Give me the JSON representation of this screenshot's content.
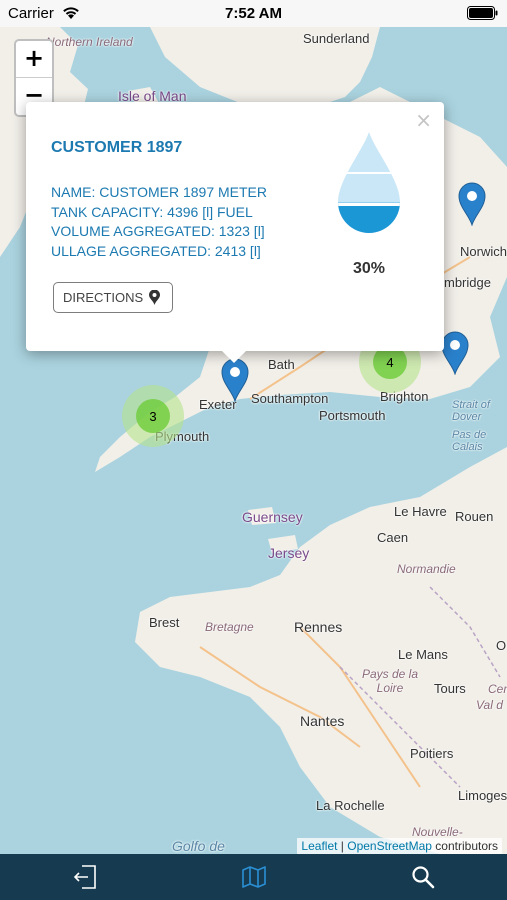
{
  "status_bar": {
    "carrier": "Carrier",
    "time": "7:52 AM"
  },
  "map": {
    "zoom_in_label": "+",
    "zoom_out_label": "−",
    "places": {
      "northern_ireland": "Northern Ireland",
      "sunderland": "Sunderland",
      "isle_of_man": "Isle of Man",
      "norwich": "Norwich",
      "cambridge": "mbridge",
      "bath": "Bath",
      "exeter": "Exeter",
      "southampton": "Southampton",
      "portsmouth": "Portsmouth",
      "brighton": "Brighton",
      "plymouth": "Plymouth",
      "strait_of_dover": "Strait of Dover",
      "pas_de_calais": "Pas de Calais",
      "guernsey": "Guernsey",
      "jersey": "Jersey",
      "le_havre": "Le Havre",
      "rouen": "Rouen",
      "caen": "Caen",
      "normandie": "Normandie",
      "brest": "Brest",
      "bretagne": "Bretagne",
      "rennes": "Rennes",
      "le_mans": "Le Mans",
      "pays_de_la_loire": "Pays de la Loire",
      "tours": "Tours",
      "nantes": "Nantes",
      "poitiers": "Poitiers",
      "la_rochelle": "La Rochelle",
      "limoges": "Limoges",
      "nouvelle": "Nouvelle-",
      "golfo": "Golfo de",
      "o_frag": "O",
      "cen": "Cen",
      "val": "Val d"
    },
    "clusters": [
      {
        "count": "3"
      },
      {
        "count": "4"
      }
    ],
    "attribution": {
      "leaflet": "Leaflet",
      "sep": " | ",
      "osm": "OpenStreetMap",
      "rest": " contributors"
    }
  },
  "popup": {
    "close_label": "×",
    "title": "CUSTOMER 1897",
    "name_line": "NAME: CUSTOMER 1897 METER",
    "capacity_line": "TANK CAPACITY: 4396 [l] FUEL",
    "volume_line": "VOLUME AGGREGATED: 1323 [l]",
    "ullage_line": "ULLAGE AGGREGATED: 2413 [l]",
    "directions_label": "DIRECTIONS",
    "fill_percent_label": "30%",
    "fill_level": 0.3
  },
  "tabbar": {
    "icons": [
      "logout-icon",
      "map-icon",
      "search-icon"
    ]
  },
  "colors": {
    "accent": "#1c7ab1",
    "tabbar_bg": "#163a4f",
    "marker": "#2a81cb",
    "cluster": "#6ecc39",
    "water": "#aad3df",
    "land": "#f2efe9"
  }
}
